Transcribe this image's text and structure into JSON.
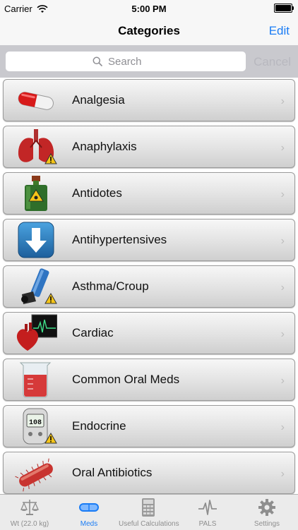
{
  "status_bar": {
    "carrier": "Carrier",
    "time": "5:00 PM"
  },
  "nav": {
    "title": "Categories",
    "edit_label": "Edit"
  },
  "search": {
    "placeholder": "Search",
    "cancel_label": "Cancel"
  },
  "categories": [
    {
      "label": "Analgesia",
      "icon": "capsule-icon",
      "warning": false
    },
    {
      "label": "Anaphylaxis",
      "icon": "lungs-icon",
      "warning": true
    },
    {
      "label": "Antidotes",
      "icon": "poison-bottle-icon",
      "warning": false
    },
    {
      "label": "Antihypertensives",
      "icon": "down-arrow-icon",
      "warning": false
    },
    {
      "label": "Asthma/Croup",
      "icon": "inhaler-icon",
      "warning": true
    },
    {
      "label": "Cardiac",
      "icon": "heart-monitor-icon",
      "warning": false
    },
    {
      "label": "Common Oral Meds",
      "icon": "beaker-icon",
      "warning": false
    },
    {
      "label": "Endocrine",
      "icon": "glucometer-icon",
      "warning": true
    },
    {
      "label": "Oral Antibiotics",
      "icon": "bacteria-icon",
      "warning": false
    }
  ],
  "glucometer_reading": "108",
  "tabs": [
    {
      "label": "Wt (22.0 kg)",
      "icon": "scale-icon",
      "active": false
    },
    {
      "label": "Meds",
      "icon": "pill-icon",
      "active": true
    },
    {
      "label": "Useful Calculations",
      "icon": "calculator-icon",
      "active": false
    },
    {
      "label": "PALS",
      "icon": "pulse-icon",
      "active": false
    },
    {
      "label": "Settings",
      "icon": "gear-icon",
      "active": false
    }
  ],
  "colors": {
    "accent": "#1a7cf5",
    "warning": "#f5c518"
  }
}
